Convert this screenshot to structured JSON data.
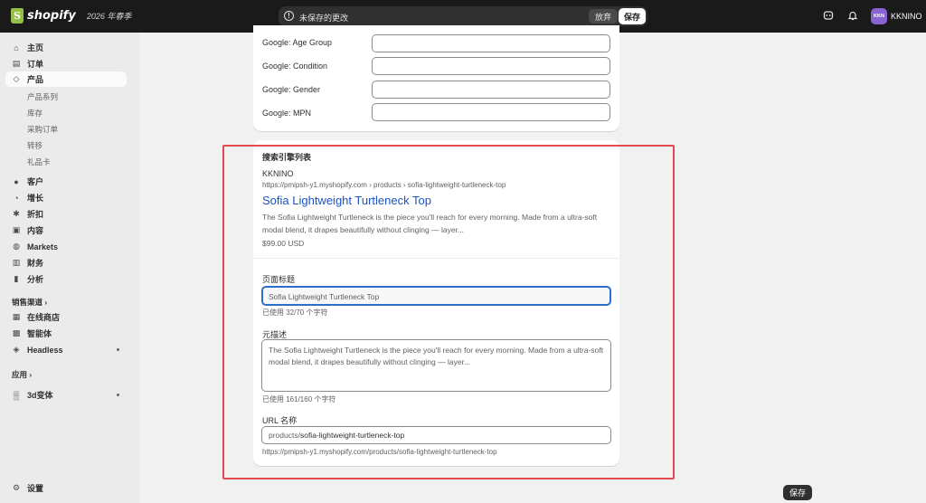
{
  "topbar": {
    "brand": "shopify",
    "edition": "2026 年春季",
    "unsaved_message": "未保存的更改",
    "discard_label": "放弃",
    "save_label": "保存",
    "avatar_initials": "KKN",
    "store_name": "KKNINO",
    "avatar_color": "#8a63d2"
  },
  "sidebar": {
    "items": [
      {
        "label": "主页",
        "icon": "home-icon",
        "glyph": "⌂"
      },
      {
        "label": "订单",
        "icon": "inbox-icon",
        "glyph": "▤"
      },
      {
        "label": "产品",
        "icon": "tag-icon",
        "glyph": "◇"
      }
    ],
    "product_subitems": [
      "产品系列",
      "库存",
      "采购订单",
      "转移",
      "礼品卡"
    ],
    "items2": [
      {
        "label": "客户",
        "icon": "person-icon",
        "glyph": "●"
      },
      {
        "label": "增长",
        "icon": "gauge-icon",
        "glyph": "◔"
      },
      {
        "label": "折扣",
        "icon": "discount-icon",
        "glyph": "✱"
      },
      {
        "label": "内容",
        "icon": "content-icon",
        "glyph": "▣"
      },
      {
        "label": "Markets",
        "icon": "globe-icon",
        "glyph": "◍"
      },
      {
        "label": "财务",
        "icon": "bank-icon",
        "glyph": "▥"
      },
      {
        "label": "分析",
        "icon": "chart-icon",
        "glyph": "▮"
      }
    ],
    "sales_channels_label": "销售渠道",
    "channels": [
      {
        "label": "在线商店",
        "icon": "store-icon",
        "glyph": "▦"
      },
      {
        "label": "智能体",
        "icon": "agent-icon",
        "glyph": "▩"
      },
      {
        "label": "Headless",
        "icon": "headless-icon",
        "glyph": "◈"
      }
    ],
    "apps_label": "应用",
    "apps": [
      {
        "label": "3d变体",
        "icon": "app-icon",
        "glyph": "▒"
      }
    ],
    "settings_label": "设置"
  },
  "google_fields": [
    {
      "label": "Google: Age Group"
    },
    {
      "label": "Google: Condition"
    },
    {
      "label": "Google: Gender"
    },
    {
      "label": "Google: MPN"
    }
  ],
  "seo": {
    "heading": "搜索引擎列表",
    "store": "KKNINO",
    "url": "https://pmipsh-y1.myshopify.com › products › sofia-lightweight-turtleneck-top",
    "title": "Sofia Lightweight Turtleneck Top",
    "description": "The Sofia Lightweight Turtleneck is the piece you'll reach for every morning. Made from a ultra-soft modal blend, it drapes beautifully without clinging — layer...",
    "price": "$99.00 USD",
    "page_title_label": "页面标题",
    "page_title_value": "Sofia Lightweight Turtleneck Top",
    "page_title_count": "已使用 32/70 个字符",
    "meta_label": "元描述",
    "meta_value": "The Sofia Lightweight Turtleneck is the piece you'll reach for every morning. Made from a ultra-soft modal blend, it drapes beautifully without clinging — layer...",
    "meta_count": "已使用 161/160 个字符",
    "url_label": "URL 名称",
    "url_prefix": "products/",
    "url_handle": "sofia-lightweight-turtleneck-top",
    "full_url": "https://pmipsh-y1.myshopify.com/products/sofia-lightweight-turtleneck-top"
  },
  "floating_save_label": "保存",
  "colors": {
    "accent_link": "#1a53c4",
    "highlight": "#e5484d",
    "focus_border": "#2c6ecb"
  }
}
